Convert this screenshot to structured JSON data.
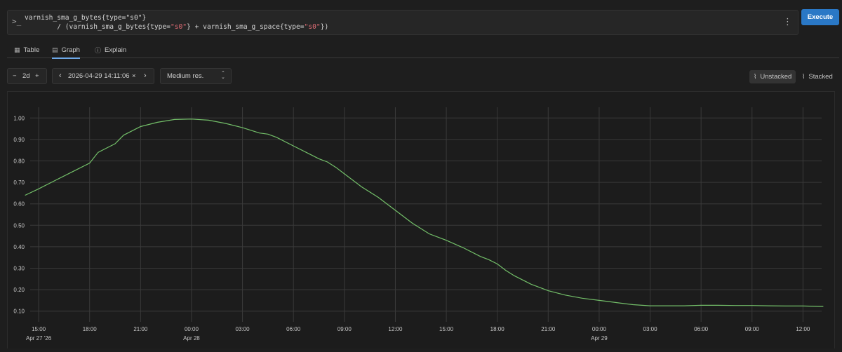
{
  "query": {
    "line1": "varnish_sma_g_bytes{type=\"s0\"}",
    "line2_a": "/ (varnish_sma_g_bytes{type=",
    "line2_b": "\"s0\"",
    "line2_c": "} + varnish_sma_g_space{type=",
    "line2_d": "\"s0\"",
    "line2_e": "})",
    "prompt_icon": "terminal-prompt-icon",
    "menu_icon": "kebab-menu-icon"
  },
  "execute_label": "Execute",
  "tabs": [
    {
      "label": "Table",
      "icon": "table-icon",
      "active": false
    },
    {
      "label": "Graph",
      "icon": "graph-icon",
      "active": true
    },
    {
      "label": "Explain",
      "icon": "info-icon",
      "active": false
    }
  ],
  "controls": {
    "range_minus": "−",
    "range_value": "2d",
    "range_plus": "+",
    "prev": "‹",
    "end_time": "2026-04-29 14:11:06",
    "clear": "×",
    "next": "›",
    "resolution": "Medium res.",
    "resolution_caret": "⌃⌄",
    "unstacked": "Unstacked",
    "stacked": "Stacked"
  },
  "colors": {
    "line": "#73bf69",
    "accent": "#2a78c6"
  },
  "chart_data": {
    "type": "line",
    "ylim": [
      0.05,
      1.05
    ],
    "xlim": [
      -0.5,
      46.1
    ],
    "y_ticks": [
      0.1,
      0.2,
      0.3,
      0.4,
      0.5,
      0.6,
      0.7,
      0.8,
      0.9,
      1.0
    ],
    "y_tick_labels": [
      "0.10",
      "0.20",
      "0.30",
      "0.40",
      "0.50",
      "0.60",
      "0.70",
      "0.80",
      "0.90",
      "1.00"
    ],
    "x_ticks": [
      {
        "x": 0,
        "label": "15:00",
        "sub": "Apr 27 '26"
      },
      {
        "x": 3,
        "label": "18:00",
        "sub": ""
      },
      {
        "x": 6,
        "label": "21:00",
        "sub": ""
      },
      {
        "x": 9,
        "label": "00:00",
        "sub": "Apr 28"
      },
      {
        "x": 12,
        "label": "03:00",
        "sub": ""
      },
      {
        "x": 15,
        "label": "06:00",
        "sub": ""
      },
      {
        "x": 18,
        "label": "09:00",
        "sub": ""
      },
      {
        "x": 21,
        "label": "12:00",
        "sub": ""
      },
      {
        "x": 24,
        "label": "15:00",
        "sub": ""
      },
      {
        "x": 27,
        "label": "18:00",
        "sub": ""
      },
      {
        "x": 30,
        "label": "21:00",
        "sub": ""
      },
      {
        "x": 33,
        "label": "00:00",
        "sub": "Apr 29"
      },
      {
        "x": 36,
        "label": "03:00",
        "sub": ""
      },
      {
        "x": 39,
        "label": "06:00",
        "sub": ""
      },
      {
        "x": 42,
        "label": "09:00",
        "sub": ""
      },
      {
        "x": 45,
        "label": "12:00",
        "sub": ""
      }
    ],
    "grid": true,
    "series": [
      {
        "x": [
          -0.8,
          0,
          1,
          2,
          3,
          3.5,
          4,
          4.5,
          5,
          6,
          7,
          8,
          9,
          10,
          11,
          12,
          13,
          13.5,
          14,
          15,
          16,
          16.5,
          17,
          17.5,
          18,
          19,
          20,
          21,
          22,
          23,
          24,
          25,
          26,
          26.5,
          27,
          27.5,
          28,
          29,
          30,
          31,
          32,
          33,
          33.5,
          34,
          35,
          36,
          37,
          38,
          39,
          40,
          41,
          42,
          43,
          44,
          45,
          46,
          46.2
        ],
        "y": [
          0.64,
          0.67,
          0.71,
          0.75,
          0.79,
          0.84,
          0.86,
          0.88,
          0.92,
          0.96,
          0.98,
          0.993,
          0.995,
          0.99,
          0.975,
          0.955,
          0.93,
          0.925,
          0.91,
          0.87,
          0.83,
          0.81,
          0.795,
          0.77,
          0.74,
          0.68,
          0.63,
          0.57,
          0.51,
          0.46,
          0.43,
          0.395,
          0.355,
          0.34,
          0.32,
          0.29,
          0.265,
          0.225,
          0.195,
          0.175,
          0.16,
          0.15,
          0.145,
          0.14,
          0.13,
          0.125,
          0.125,
          0.125,
          0.127,
          0.127,
          0.126,
          0.126,
          0.125,
          0.124,
          0.124,
          0.122,
          0.122
        ]
      }
    ]
  }
}
